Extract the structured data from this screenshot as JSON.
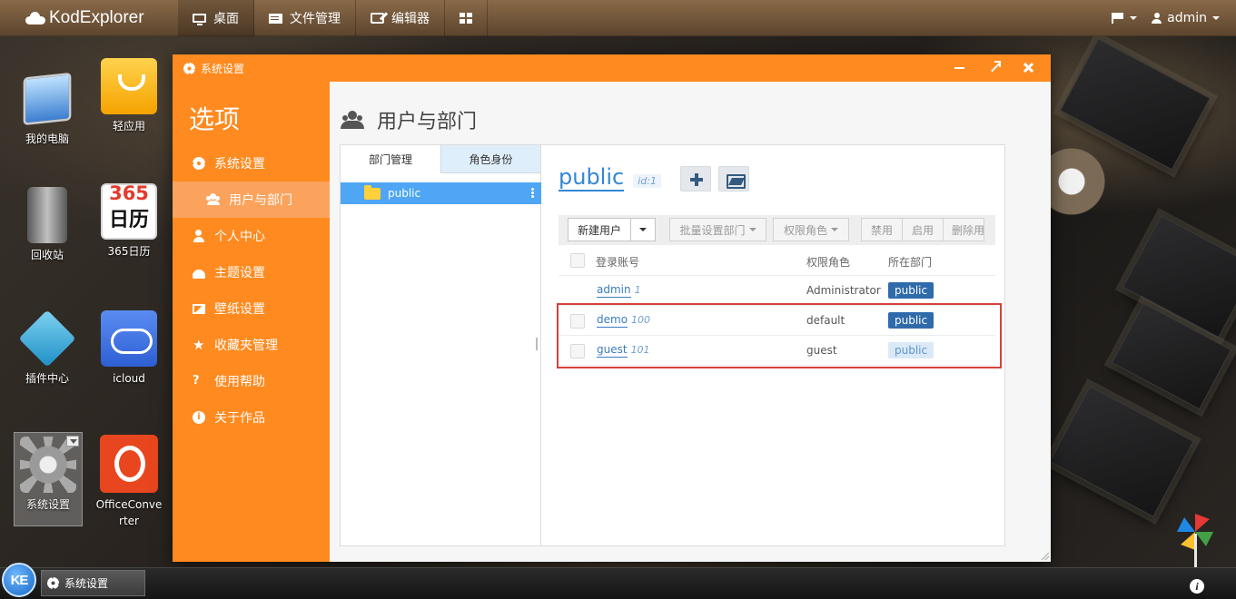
{
  "topbar": {
    "logo": "KodExplorer",
    "nav": [
      {
        "label": "桌面",
        "icon": "desktop-icon"
      },
      {
        "label": "文件管理",
        "icon": "file-manager-icon"
      },
      {
        "label": "编辑器",
        "icon": "editor-icon"
      },
      {
        "label": "",
        "icon": "grid-icon"
      }
    ],
    "user": "admin"
  },
  "desktop": {
    "icons": [
      {
        "label": "我的电脑",
        "icon": "computer-icon"
      },
      {
        "label": "轻应用",
        "icon": "light-app-icon"
      },
      {
        "label": "回收站",
        "icon": "recycle-bin-icon"
      },
      {
        "label": "365日历",
        "icon": "calendar-icon",
        "cal_num": "365",
        "cal_txt": "日历"
      },
      {
        "label": "插件中心",
        "icon": "plugin-center-icon"
      },
      {
        "label": "icloud",
        "icon": "icloud-icon"
      },
      {
        "label": "系统设置",
        "icon": "system-settings-icon"
      },
      {
        "label": "OfficeConverter",
        "icon": "office-converter-icon"
      }
    ]
  },
  "window": {
    "title": "系统设置",
    "sidebar": {
      "title": "选项",
      "items": [
        {
          "label": "系统设置",
          "icon": "gear-icon"
        },
        {
          "label": "用户与部门",
          "icon": "users-icon",
          "active": true
        },
        {
          "label": "个人中心",
          "icon": "user-icon"
        },
        {
          "label": "主题设置",
          "icon": "dashboard-icon"
        },
        {
          "label": "壁纸设置",
          "icon": "picture-icon"
        },
        {
          "label": "收藏夹管理",
          "icon": "star-icon"
        },
        {
          "label": "使用帮助",
          "icon": "question-icon"
        },
        {
          "label": "关于作品",
          "icon": "info-icon"
        }
      ]
    },
    "content": {
      "heading": "用户与部门",
      "tabs": [
        "部门管理",
        "角色身份"
      ],
      "tree": {
        "root": "public"
      },
      "dept": {
        "name": "public",
        "id_label": "id:1"
      },
      "toolbar": {
        "new_user": "新建用户",
        "batch_dept": "批量设置部门",
        "role": "权限角色",
        "disable": "禁用",
        "enable": "启用",
        "delete": "删除用户"
      },
      "table": {
        "headers": {
          "account": "登录账号",
          "role": "权限角色",
          "dept": "所在部门"
        },
        "rows": [
          {
            "name": "admin",
            "id": "1",
            "role": "Administrator",
            "dept": "public",
            "dept_style": "dark"
          },
          {
            "name": "demo",
            "id": "100",
            "role": "default",
            "dept": "public",
            "dept_style": "dark"
          },
          {
            "name": "guest",
            "id": "101",
            "role": "guest",
            "dept": "public",
            "dept_style": "light"
          }
        ]
      }
    }
  },
  "taskbar": {
    "start": "KE",
    "tasks": [
      {
        "label": "系统设置"
      }
    ]
  },
  "colors": {
    "accent": "#ff8a1f",
    "link": "#3387d6",
    "highlight": "#d9403b"
  }
}
